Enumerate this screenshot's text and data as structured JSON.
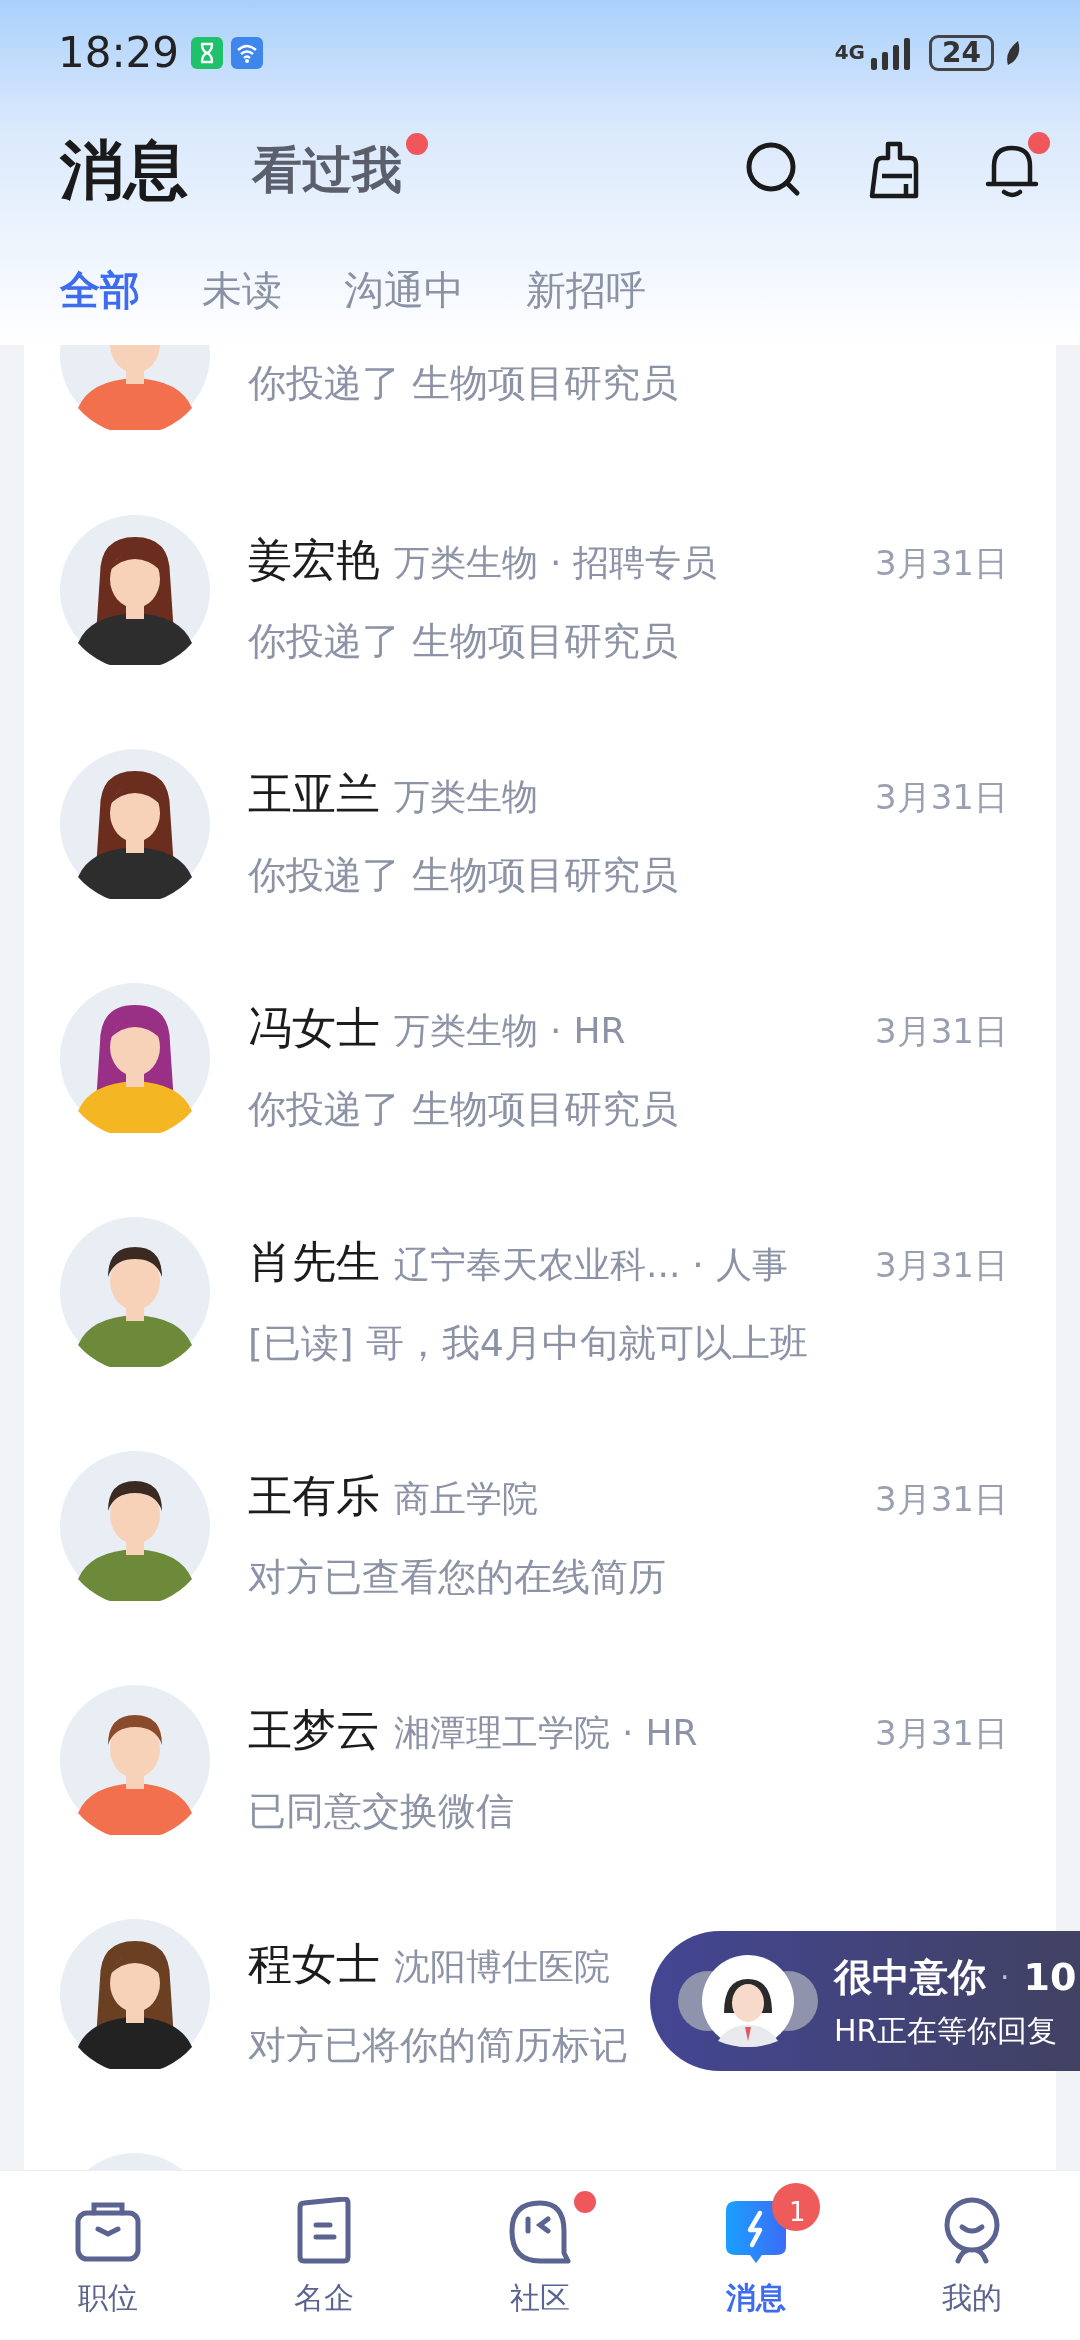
{
  "status_bar": {
    "time": "18:29",
    "network": "4G",
    "battery": "24"
  },
  "header": {
    "tabs": [
      {
        "label": "消息",
        "selected": true,
        "dot": false
      },
      {
        "label": "看过我",
        "selected": false,
        "dot": true
      }
    ],
    "bell_dot": true
  },
  "filters": [
    {
      "label": "全部",
      "selected": true
    },
    {
      "label": "未读",
      "selected": false
    },
    {
      "label": "沟通中",
      "selected": false
    },
    {
      "label": "新招呼",
      "selected": false
    }
  ],
  "separator": "·",
  "conversations": [
    {
      "kind": "cut_top",
      "message": "你投递了 生物项目研究员"
    },
    {
      "kind": "full",
      "name": "姜宏艳",
      "company": "万类生物",
      "role": "招聘专员",
      "date": "3月31日",
      "message": "你投递了 生物项目研究员"
    },
    {
      "kind": "full",
      "name": "王亚兰",
      "company": "万类生物",
      "date": "3月31日",
      "message": "你投递了 生物项目研究员"
    },
    {
      "kind": "full",
      "name": "冯女士",
      "company": "万类生物",
      "role": "HR",
      "date": "3月31日",
      "message": "你投递了 生物项目研究员"
    },
    {
      "kind": "full",
      "name": "肖先生",
      "company": "辽宁奉天农业科...",
      "role": "人事",
      "date": "3月31日",
      "message": "[已读] 哥，我4月中旬就可以上班"
    },
    {
      "kind": "full",
      "name": "王有乐",
      "company": "商丘学院",
      "date": "3月31日",
      "message": "对方已查看您的在线简历"
    },
    {
      "kind": "full",
      "name": "王梦云",
      "company": "湘潭理工学院",
      "role": "HR",
      "date": "3月31日",
      "message": "已同意交换微信"
    },
    {
      "kind": "full",
      "name": "程女士",
      "company": "沈阳博仕医院",
      "message": "对方已将你的简历标记"
    },
    {
      "kind": "cut_bottom"
    }
  ],
  "popup": {
    "title": "很中意你",
    "count": "10",
    "subtitle": "HR正在等你回复"
  },
  "nav": [
    {
      "label": "职位",
      "selected": false,
      "dot": false
    },
    {
      "label": "名企",
      "selected": false,
      "dot": false
    },
    {
      "label": "社区",
      "selected": false,
      "dot": true
    },
    {
      "label": "消息",
      "selected": true,
      "dot": false,
      "badge": "1"
    },
    {
      "label": "我的",
      "selected": false,
      "dot": false
    }
  ]
}
